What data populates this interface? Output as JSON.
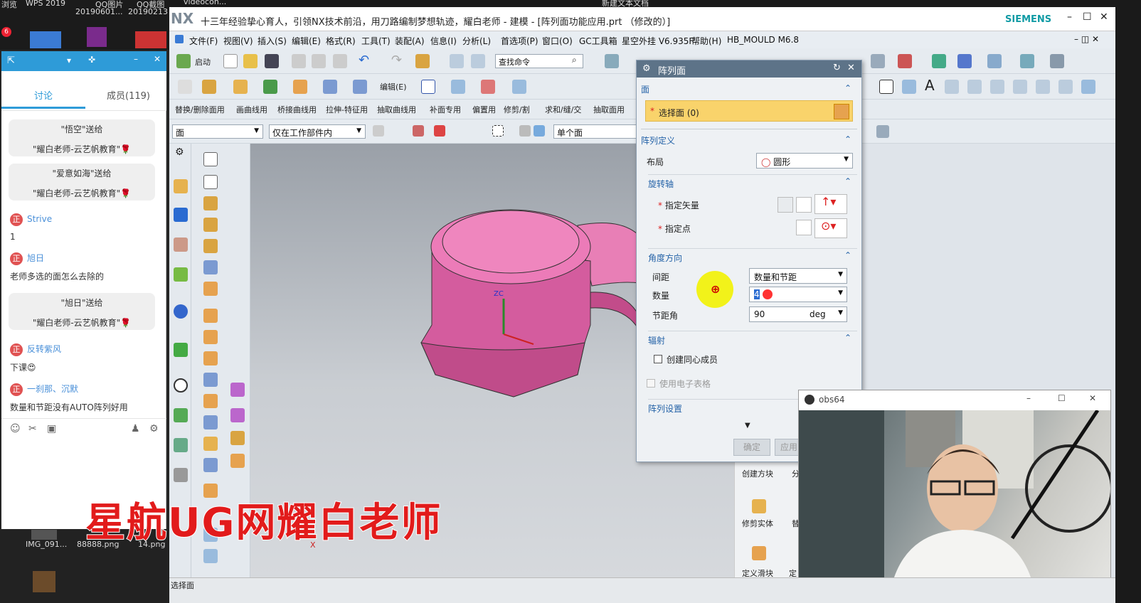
{
  "desktop": {
    "top_labels": [
      "浏览",
      "WPS 2019",
      "QQ图片",
      "20190601...",
      "QQ截图",
      "20190213"
    ],
    "badge": "6",
    "bottom_labels": [
      "IMG_091...",
      "88888.png",
      "14.png"
    ],
    "top_truncated": [
      "videocon...",
      "新建文本文档"
    ]
  },
  "chat": {
    "tabs": [
      "讨论",
      "成员(119)"
    ],
    "messages": [
      {
        "type": "gift",
        "line1": "\"悟空\"送给",
        "line2": "\"耀白老师-云艺帆教育\""
      },
      {
        "type": "gift",
        "line1": "\"爱意如海\"送给",
        "line2": "\"耀白老师-云艺帆教育\""
      },
      {
        "type": "msg",
        "name": "Strive",
        "text": "1"
      },
      {
        "type": "msg",
        "name": "旭日",
        "text": "老师多选的面怎么去除的"
      },
      {
        "type": "gift",
        "line1": "\"旭日\"送给",
        "line2": "\"耀白老师-云艺帆教育\""
      },
      {
        "type": "msg",
        "name": "反转紫风",
        "text": "下课"
      },
      {
        "type": "msg",
        "name": "一刹那、沉默",
        "text": "数量和节距没有AUTO阵列好用"
      }
    ],
    "badge_char": "正"
  },
  "nx": {
    "logo": "NX",
    "title": "十三年经验挚心育人，引领NX技术前沿，用刀路编制梦想轨迹，耀白老师 - 建模 - [阵列面功能应用.prt （修改的）]",
    "brand": "SIEMENS",
    "menu": [
      "文件(F)",
      "视图(V)",
      "插入(S)",
      "编辑(E)",
      "格式(R)",
      "工具(T)",
      "装配(A)",
      "信息(I)",
      "分析(L)",
      "首选项(P)",
      "窗口(O)",
      "GC工具箱",
      "星空外挂 V6.935F",
      "帮助(H)",
      "HB_MOULD M6.8"
    ],
    "start_label": "启动",
    "search_placeholder": "查找命令",
    "edit_label": "编辑(E)",
    "surface_menu": [
      "替换/删除面用",
      "画曲线用",
      "桥接曲线用",
      "拉伸-特征用",
      "抽取曲线用",
      "补面专用",
      "偏置用",
      "修剪/割",
      "求和/缝/交",
      "抽取面用"
    ],
    "filter1": "面",
    "filter2": "仅在工作部件内",
    "filter3": "单个面",
    "status": "选择面",
    "right_panel": [
      "创建方块",
      "修剪实体",
      "定义滑块"
    ],
    "right_panel_cut": [
      "分",
      "替",
      "定"
    ]
  },
  "dialog": {
    "title": "阵列面",
    "sec_face": "面",
    "select_face": "选择面 (0)",
    "sec_array": "阵列定义",
    "layout_label": "布局",
    "layout_value": "圆形",
    "sec_axis": "旋转轴",
    "specify_vector": "指定矢量",
    "specify_point": "指定点",
    "sec_angle": "角度方向",
    "spacing_label": "间距",
    "spacing_value": "数量和节距",
    "count_label": "数量",
    "count_value": "4",
    "pitch_label": "节距角",
    "pitch_value": "90",
    "pitch_unit": "deg",
    "sec_radial": "辐射",
    "create_concentric": "创建同心成员",
    "use_spreadsheet": "使用电子表格",
    "sec_settings": "阵列设置",
    "ok": "确定",
    "apply": "应用"
  },
  "obs": {
    "title": "obs64"
  },
  "watermark": "星航UG网耀白老师",
  "axis_label": "X",
  "colors": {
    "accent": "#2563a8",
    "highlight": "#f9d36b",
    "part": "#d95a9a"
  }
}
